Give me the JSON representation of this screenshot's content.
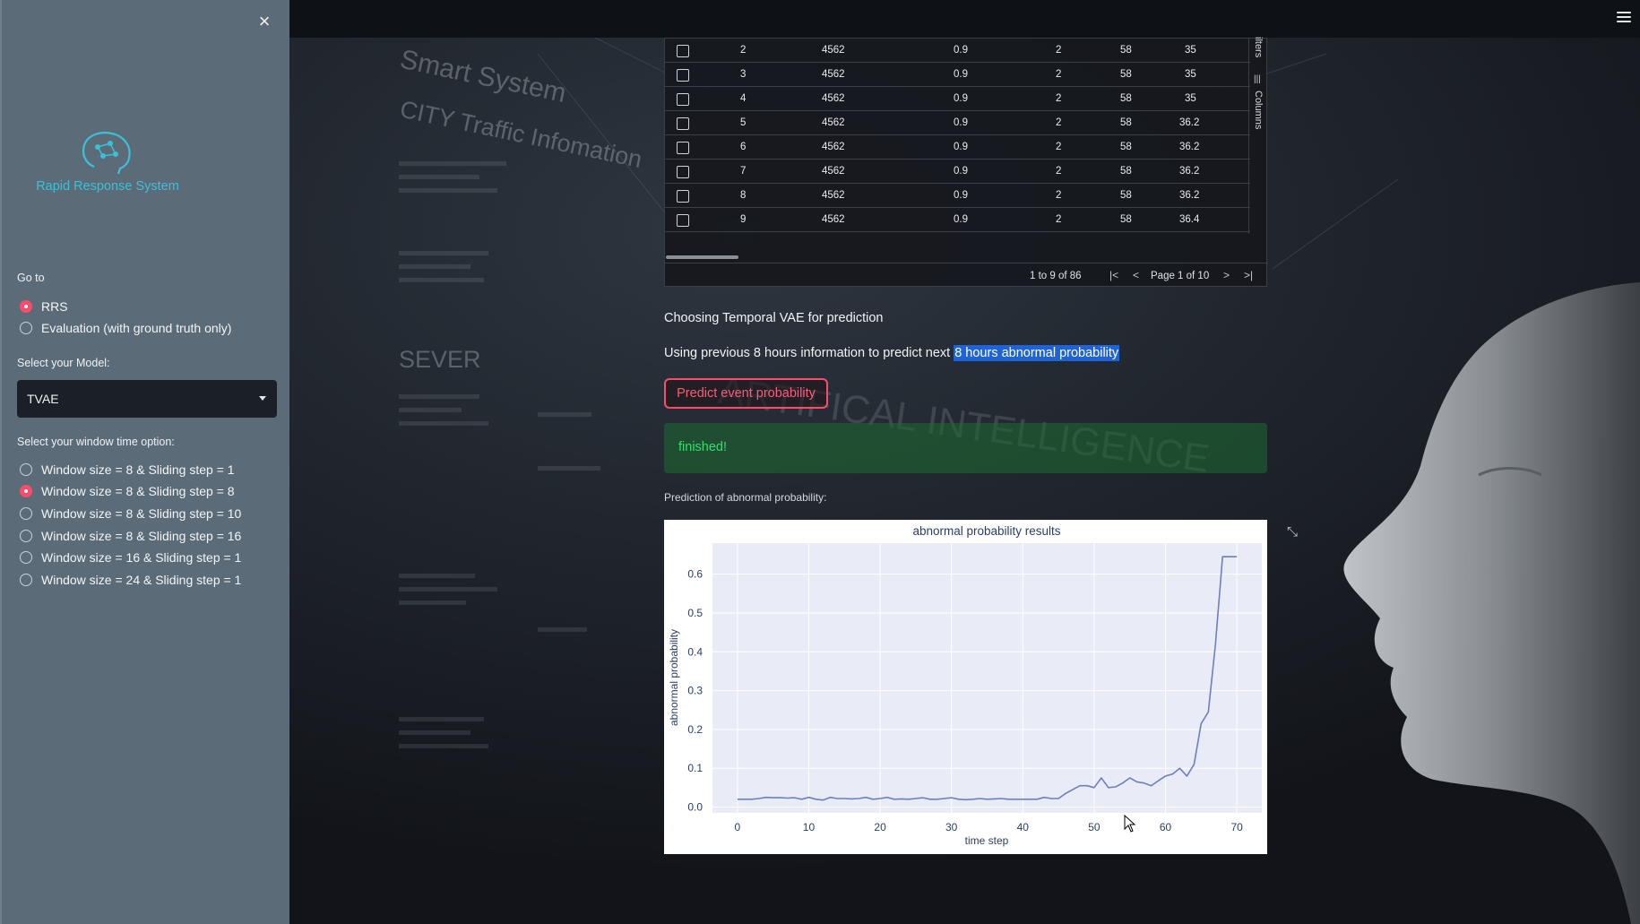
{
  "sidebar": {
    "close_label": "×",
    "logo_text": "Rapid Response System",
    "goto_label": "Go to",
    "goto_options": [
      {
        "label": "RRS",
        "checked": true
      },
      {
        "label": "Evaluation (with ground truth only)",
        "checked": false
      }
    ],
    "model_label": "Select your Model:",
    "model_value": "TVAE",
    "window_label": "Select your window time option:",
    "window_options": [
      {
        "label": "Window size = 8 & Sliding step = 1",
        "checked": false
      },
      {
        "label": "Window size = 8 & Sliding step = 8",
        "checked": true
      },
      {
        "label": "Window size = 8 & Sliding step = 10",
        "checked": false
      },
      {
        "label": "Window size = 8 & Sliding step = 16",
        "checked": false
      },
      {
        "label": "Window size = 16 & Sliding step = 1",
        "checked": false
      },
      {
        "label": "Window size = 24 & Sliding step = 1",
        "checked": false
      }
    ]
  },
  "table": {
    "rows": [
      [
        "2",
        "4562",
        "0.9",
        "2",
        "58",
        "35"
      ],
      [
        "3",
        "4562",
        "0.9",
        "2",
        "58",
        "35"
      ],
      [
        "4",
        "4562",
        "0.9",
        "2",
        "58",
        "35"
      ],
      [
        "5",
        "4562",
        "0.9",
        "2",
        "58",
        "36.2"
      ],
      [
        "6",
        "4562",
        "0.9",
        "2",
        "58",
        "36.2"
      ],
      [
        "7",
        "4562",
        "0.9",
        "2",
        "58",
        "36.2"
      ],
      [
        "8",
        "4562",
        "0.9",
        "2",
        "58",
        "36.2"
      ],
      [
        "9",
        "4562",
        "0.9",
        "2",
        "58",
        "36.4"
      ]
    ],
    "side_filters_label": "ilters",
    "side_columns_label": "Columns",
    "pager_summary": "1 to 9 of 86",
    "pager_page": "Page 1 of 10",
    "pager_first": "|<",
    "pager_prev": "<",
    "pager_next": ">",
    "pager_last": ">|"
  },
  "main": {
    "model_choice_text": "Choosing Temporal VAE for prediction",
    "using_text_prefix": "Using previous 8 hours information to predict next ",
    "using_text_highlight": "8 hours abnormal probability",
    "predict_button_label": "Predict event probability",
    "status_message": "finished!",
    "prediction_label": "Prediction of abnormal probability:"
  },
  "colors": {
    "accent": "#ff4b6b",
    "sidebar_bg": "#5b6b78",
    "success_text": "#2fe06a",
    "highlight": "#1f63d6",
    "line": "#6f7fc0",
    "plot_bg": "#e9ecf6"
  },
  "icons": {
    "close": "close-icon",
    "menu": "hamburger-menu-icon",
    "expand": "fullscreen-expand-icon",
    "logo": "brain-network-logo-icon"
  },
  "chart_data": {
    "type": "line",
    "title": "abnormal probability results",
    "xlabel": "time step",
    "ylabel": "abnormal probability",
    "xlim": [
      -3.5,
      73.5
    ],
    "ylim": [
      -0.015,
      0.68
    ],
    "xticks": [
      0,
      10,
      20,
      30,
      40,
      50,
      60,
      70
    ],
    "yticks": [
      0.0,
      0.1,
      0.2,
      0.3,
      0.4,
      0.5,
      0.6
    ],
    "ytick_labels": [
      "0.0",
      "0.1",
      "0.2",
      "0.3",
      "0.4",
      "0.5",
      "0.6"
    ],
    "grid": true,
    "series": [
      {
        "x": [
          0,
          1,
          2,
          3,
          4,
          5,
          6,
          7,
          8,
          9,
          10,
          11,
          12,
          13,
          14,
          15,
          16,
          17,
          18,
          19,
          20,
          21,
          22,
          23,
          24,
          25,
          26,
          27,
          28,
          29,
          30,
          31,
          32,
          33,
          34,
          35,
          36,
          37,
          38,
          39,
          40,
          41,
          42,
          43,
          44,
          45,
          46,
          47,
          48,
          49,
          50,
          51,
          52,
          53,
          54,
          55,
          56,
          57,
          58,
          59,
          60,
          61,
          62,
          63,
          64,
          65,
          66,
          67,
          68,
          69,
          70
        ],
        "y": [
          0.02,
          0.02,
          0.02,
          0.022,
          0.025,
          0.024,
          0.024,
          0.023,
          0.024,
          0.02,
          0.025,
          0.02,
          0.018,
          0.025,
          0.022,
          0.022,
          0.021,
          0.022,
          0.025,
          0.02,
          0.022,
          0.025,
          0.02,
          0.021,
          0.02,
          0.022,
          0.024,
          0.02,
          0.02,
          0.022,
          0.024,
          0.02,
          0.019,
          0.02,
          0.022,
          0.02,
          0.021,
          0.022,
          0.02,
          0.02,
          0.02,
          0.02,
          0.02,
          0.025,
          0.022,
          0.022,
          0.035,
          0.045,
          0.055,
          0.055,
          0.05,
          0.075,
          0.05,
          0.052,
          0.062,
          0.075,
          0.065,
          0.062,
          0.055,
          0.068,
          0.08,
          0.085,
          0.1,
          0.08,
          0.11,
          0.215,
          0.245,
          0.42,
          0.645,
          0.645,
          0.645
        ]
      }
    ]
  }
}
